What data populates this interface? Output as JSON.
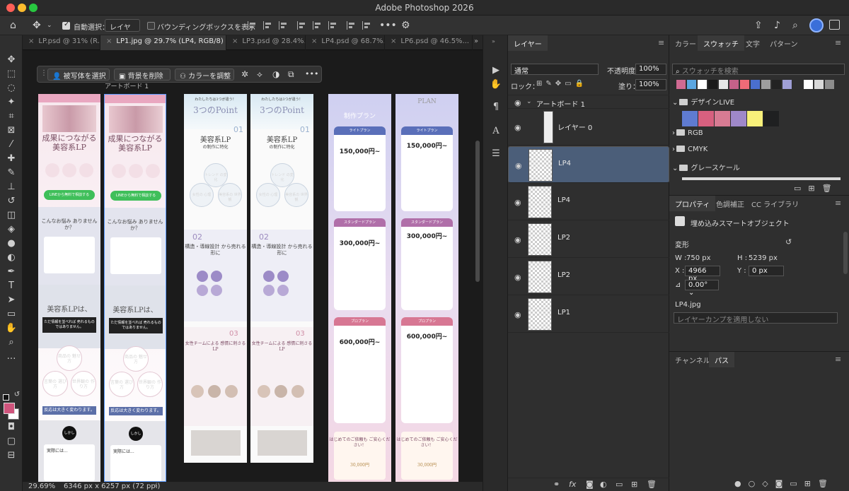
{
  "app": {
    "title": "Adobe Photoshop 2026"
  },
  "options": {
    "auto_select_label": "自動選択：",
    "auto_select_value": "レイヤー",
    "bbox_label": "バウンディングボックスを表示",
    "more": "•••"
  },
  "tabs": [
    {
      "label": "LP.psd @ 31% (R..."
    },
    {
      "label": "LP1.jpg @ 29.7% (LP4, RGB/8) *"
    },
    {
      "label": "LP3.psd @ 28.4%..."
    },
    {
      "label": "LP4.psd @ 68.7%..."
    },
    {
      "label": "LP6.psd @ 46.5%..."
    }
  ],
  "context_bar": {
    "select_subject": "被写体を選択",
    "remove_bg": "背景を削除",
    "adjust_color": "カラーを調整",
    "more": "•••"
  },
  "canvas": {
    "artboard_label": "アートボード 1",
    "doc1": {
      "headline": "成果につながる 美容系LP",
      "line_btn": "LINEから無料で相談する",
      "worry": "こんなお悩み ありませんか？",
      "beauty_lp": "美容系LPは、",
      "notice": "ただ情報を並べれば 売れるものではありません。",
      "circles": [
        "商品の 魅せ方",
        "言葉の 選び方",
        "世界観の 作り方"
      ],
      "conclusion": "反応は大きく変わります。",
      "dark_btn": "しかし",
      "real": "実際には..."
    },
    "doc2": {
      "head": "わたしたちは3つが違う！",
      "three": "3つのPoint",
      "beauty_lp": "美容系LP",
      "specialty": "の制作に特化",
      "num1": "01",
      "trend": "トレンド の変化",
      "f_psych": "女性の 心理",
      "beauty_view": "美容系の 世界観",
      "num2": "02",
      "structure": "構造・導線設計 から売れる形に",
      "num3": "03",
      "team": "女性チームによる 感情に刺さるLP"
    },
    "doc3": {
      "plan_title": "制作プラン",
      "plan_sub": "PLAN",
      "light": "ライトプラン",
      "light_price": "150,000円~",
      "standard": "スタンダードプラン",
      "standard_price": "300,000円~",
      "pro": "プロプラン",
      "pro_price": "600,000円~",
      "cta": "はじめてのご依頼も ご安心ください！",
      "coupon": "30,000円"
    }
  },
  "status": {
    "zoom": "29.69%",
    "doc_size": "6346 px x 6257 px (72 ppi)"
  },
  "layers_panel": {
    "tab": "レイヤー",
    "blend_mode": "通常",
    "opacity_label": "不透明度：",
    "opacity_value": "100%",
    "lock_label": "ロック：",
    "fill_label": "塗り：",
    "fill_value": "100%",
    "group_name": "アートボード 1",
    "layers": [
      "レイヤー 0",
      "LP4",
      "LP4",
      "LP2",
      "LP2",
      "LP1"
    ]
  },
  "right_panels": {
    "tabs_top": [
      "カラー",
      "スウォッチ",
      "文字",
      "パターン"
    ],
    "swatch_search_placeholder": "スウォッチを検索",
    "swatch_colors": [
      "#d06a92",
      "#5ba6e0",
      "#ffffff",
      "#1a1a1a",
      "#e6e6e6",
      "#c56189",
      "#f06b77",
      "#4a6fcf",
      "#9e9e9e",
      "#222222",
      "#9f9fd6",
      "#303030",
      "#ffffff",
      "#d9d9d9",
      "#8d8d8d"
    ],
    "groups": [
      "デザインLIVE",
      "RGB",
      "CMYK",
      "グレースケール"
    ],
    "design_live_colors": [
      "#5f7bd1",
      "#d7607f",
      "#d77b93",
      "#9f88c9",
      "#f7f07a",
      "#1f2021"
    ],
    "prop_tabs": [
      "プロパティ",
      "色調補正",
      "CC ライブラリ"
    ],
    "smart_object": "埋め込みスマートオブジェクト",
    "transform_label": "変形",
    "w_label": "W :",
    "w_value": "750 px",
    "h_label": "H :",
    "h_value": "5239 px",
    "x_label": "X :",
    "x_value": "4966 px",
    "y_label": "Y :",
    "y_value": "0 px",
    "angle_value": "0.00°",
    "file_name": "LP4.jpg",
    "layer_comp": "レイヤーカンプを適用しない",
    "bottom_tabs": [
      "チャンネル",
      "パス"
    ]
  }
}
